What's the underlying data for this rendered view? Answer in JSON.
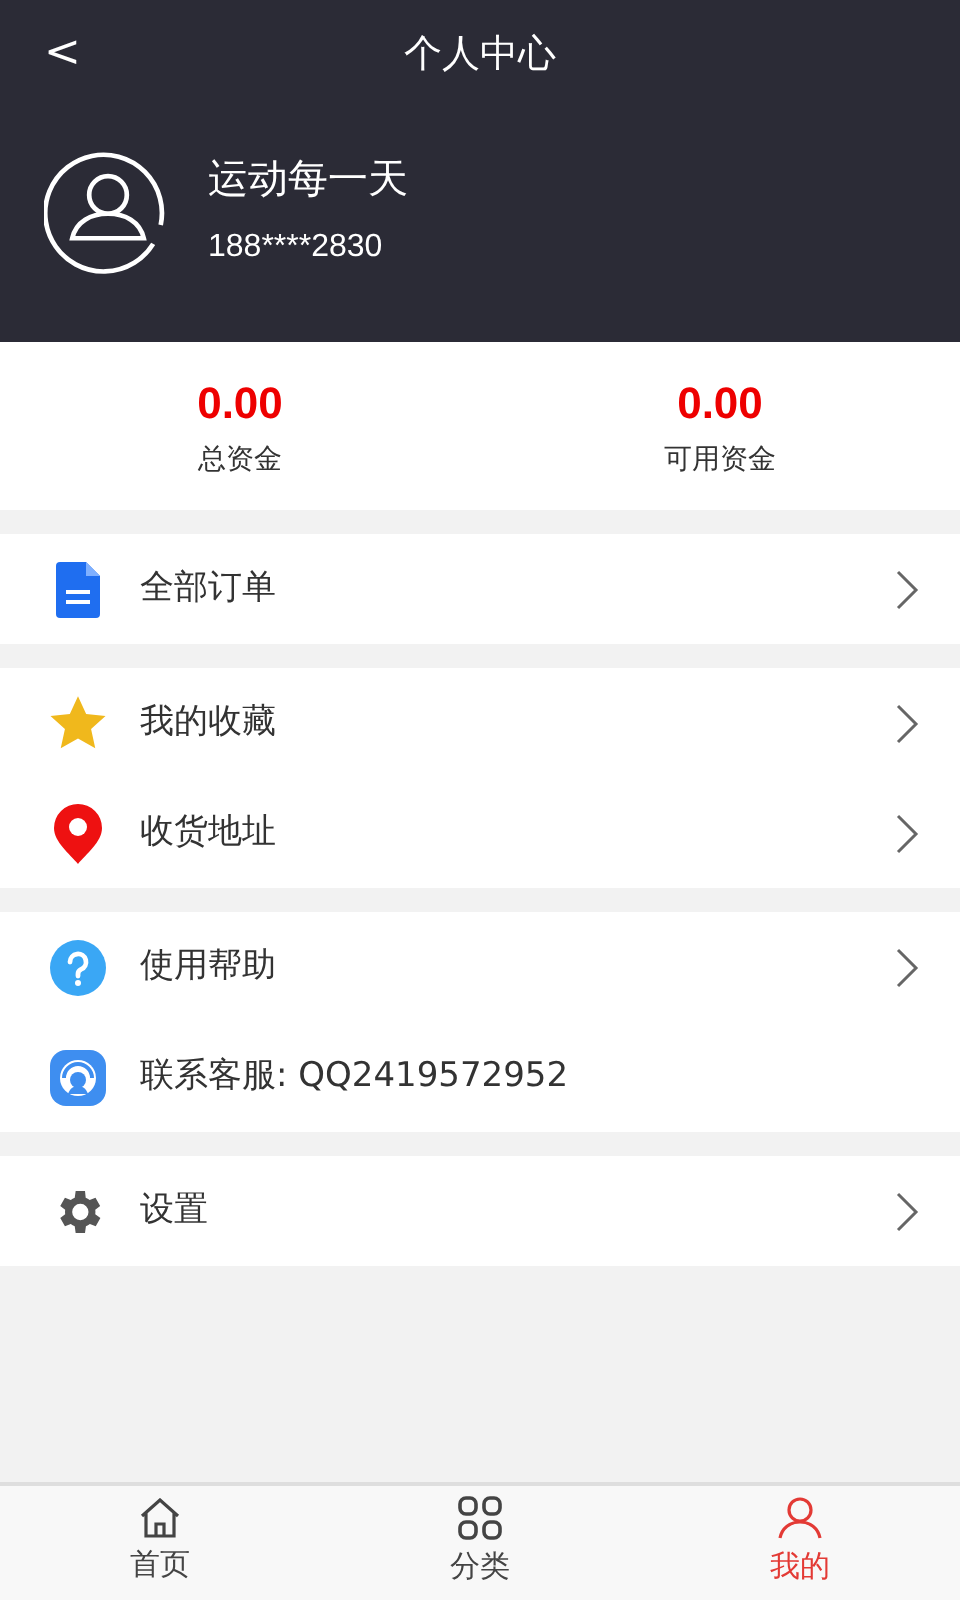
{
  "header": {
    "title": "个人中心",
    "back": "<"
  },
  "profile": {
    "name": "运动每一天",
    "phone": "188****2830"
  },
  "funds": [
    {
      "amount": "0.00",
      "label": "总资金"
    },
    {
      "amount": "0.00",
      "label": "可用资金"
    }
  ],
  "menu_groups": [
    [
      {
        "kind": "orders",
        "label": "全部订单",
        "arrow": true
      }
    ],
    [
      {
        "kind": "favorites",
        "label": "我的收藏",
        "arrow": true
      },
      {
        "kind": "address",
        "label": "收货地址",
        "arrow": true
      }
    ],
    [
      {
        "kind": "help",
        "label": "使用帮助",
        "arrow": true
      },
      {
        "kind": "service",
        "label": "联系客服: QQ2419572952",
        "arrow": false
      }
    ],
    [
      {
        "kind": "settings",
        "label": "设置",
        "arrow": true
      }
    ]
  ],
  "tab_bar": [
    {
      "kind": "home",
      "label": "首页",
      "selected": false
    },
    {
      "kind": "category",
      "label": "分类",
      "selected": false
    },
    {
      "kind": "profile",
      "label": "我的",
      "selected": true
    }
  ]
}
